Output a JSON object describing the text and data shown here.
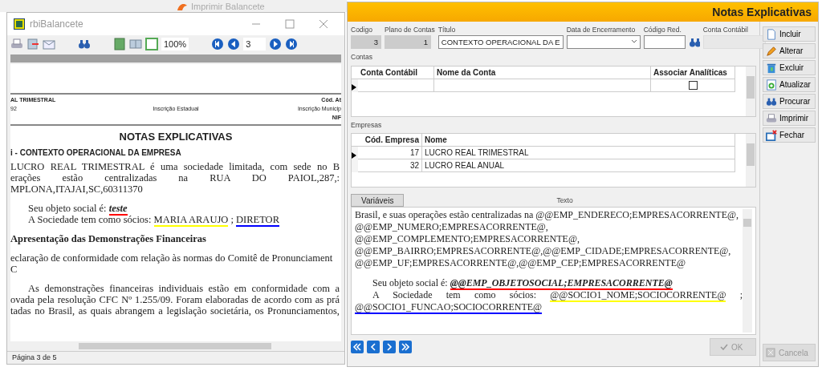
{
  "background_window": {
    "title": "Imprimir Balancete"
  },
  "report_window": {
    "title": "rbiBalancete",
    "zoom": "100%",
    "page_field": "3",
    "header_rows": [
      [
        "AL TRIMESTRAL",
        "",
        "Cód. At"
      ],
      [
        "92",
        "Inscrição Estadual",
        "Inscrição Municip"
      ],
      [
        "",
        "",
        "NIF"
      ]
    ],
    "heading": "NOTAS EXPLICATIVAS",
    "section": "i - CONTEXTO OPERACIONAL DA EMPRESA",
    "lines": [
      {
        "kind": "justify",
        "segments": [
          {
            "text": "LUCRO REAL TRIMESTRAL é uma sociedade limitada, com sede no B"
          }
        ]
      },
      {
        "kind": "justify",
        "segments": [
          {
            "text": "erações estão centralizadas na RUA DO PAIOL,287,:"
          }
        ]
      },
      {
        "kind": "plain",
        "segments": [
          {
            "text": "MPLONA,ITAJAI,SC,60311370"
          }
        ]
      },
      {
        "kind": "gap"
      },
      {
        "kind": "indent",
        "segments": [
          {
            "text": "Seu objeto social é: "
          },
          {
            "text": "teste",
            "color": "#ff0000",
            "kind": "emphasis"
          }
        ]
      },
      {
        "kind": "indent",
        "segments": [
          {
            "text": "A Sociedade tem como sócios: "
          },
          {
            "text": "MARIA ARAUJO",
            "color": "#ffff00"
          },
          {
            "text": " ; "
          },
          {
            "text": "DIRETOR",
            "color": "#0000ff"
          }
        ]
      },
      {
        "kind": "gap"
      },
      {
        "kind": "subheading",
        "segments": [
          {
            "text": "Apresentação das Demonstrações Financeiras"
          }
        ]
      },
      {
        "kind": "gap"
      },
      {
        "kind": "plain",
        "segments": [
          {
            "text": "eclaração de conformidade com relação às normas do Comitê de Pronunciament"
          }
        ]
      },
      {
        "kind": "plain",
        "segments": [
          {
            "text": "C"
          }
        ]
      },
      {
        "kind": "gap"
      },
      {
        "kind": "justify-indent",
        "segments": [
          {
            "text": "As demonstrações financeiras individuais estão em conformidade com a"
          }
        ]
      },
      {
        "kind": "justify",
        "segments": [
          {
            "text": "ovada pela resolução CFC Nº 1.255/09. Foram elaboradas de acordo com as prá"
          }
        ]
      },
      {
        "kind": "justify",
        "segments": [
          {
            "text": "tadas no Brasil, as quais abrangem a legislação societária, os Pronunciamentos,"
          }
        ]
      }
    ],
    "status": "Página 3 de 5"
  },
  "form_window": {
    "title": "Notas Explicativas",
    "fields": [
      {
        "label": "Codigo",
        "value": "3",
        "kind": "readonly"
      },
      {
        "label": "Plano de Contas",
        "value": "1",
        "kind": "readonly"
      },
      {
        "label": "Título",
        "value": "CONTEXTO OPERACIONAL DA E",
        "kind": "text"
      },
      {
        "label": "Data de Encerramento",
        "kind": "dropdown"
      },
      {
        "label": "Código Red.",
        "kind": "lookup"
      },
      {
        "label": "Conta Contábil",
        "kind": "readonly-wide"
      }
    ],
    "contas": {
      "label": "Contas",
      "columns": [
        "Conta Contábil",
        "Nome da Conta",
        "Associar Analíticas"
      ],
      "rows": [
        {
          "current": true,
          "checked": false
        }
      ]
    },
    "empresas": {
      "label": "Empresas",
      "columns": [
        "Cód. Empresa",
        "Nome"
      ],
      "rows": [
        {
          "code": "17",
          "name": "LUCRO REAL TRIMESTRAL",
          "current": true
        },
        {
          "code": "32",
          "name": "LUCRO REAL ANUAL",
          "current": false
        }
      ]
    },
    "variables_button": "Variáveis",
    "text_label": "Texto",
    "text_lines": [
      {
        "kind": "plain",
        "segments": [
          {
            "text": "Brasil,  e suas operações estão centralizadas na @@EMP_ENDERECO;EMPRESACORRENTE@,"
          }
        ]
      },
      {
        "kind": "plain",
        "segments": [
          {
            "text": "@@EMP_NUMERO;EMPRESACORRENTE@,"
          }
        ]
      },
      {
        "kind": "plain",
        "segments": [
          {
            "text": "@@EMP_COMPLEMENTO;EMPRESACORRENTE@,"
          }
        ]
      },
      {
        "kind": "plain",
        "segments": [
          {
            "text": "@@EMP_BAIRRO;EMPRESACORRENTE@,@@EMP_CIDADE;EMPRESACORRENTE@,"
          }
        ]
      },
      {
        "kind": "plain",
        "segments": [
          {
            "text": "@@EMP_UF;EMPRESACORRENTE@,@@EMP_CEP;EMPRESACORRENTE@"
          }
        ]
      },
      {
        "kind": "gap"
      },
      {
        "kind": "indent",
        "segments": [
          {
            "text": "Seu objeto social é: "
          },
          {
            "text": "@@EMP_OBJETOSOCIAL;EMPRESACORRENTE@",
            "color": "#ff0000",
            "kind": "emphasis"
          }
        ]
      },
      {
        "kind": "justify-indent",
        "segments": [
          {
            "text": "A Sociedade tem como sócios: "
          },
          {
            "text": "@@SOCIO1_NOME;SOCIOCORRENTE@",
            "color": "#ffff00"
          },
          {
            "text": " ;"
          }
        ]
      },
      {
        "kind": "plain",
        "segments": [
          {
            "text": "@@SOCIO1_FUNCAO;SOCIOCORRENTE@",
            "color": "#0000ff"
          }
        ]
      }
    ],
    "ok_button": {
      "label": "OK",
      "disabled": true
    },
    "cancel_button": {
      "label": "Cancela",
      "disabled": true
    },
    "side_buttons": [
      {
        "label": "Incluir"
      },
      {
        "label": "Alterar"
      },
      {
        "label": "Excluir"
      },
      {
        "label": "Atualizar"
      },
      {
        "label": "Procurar"
      },
      {
        "label": "Imprimir"
      },
      {
        "label": "Fechar"
      }
    ]
  }
}
